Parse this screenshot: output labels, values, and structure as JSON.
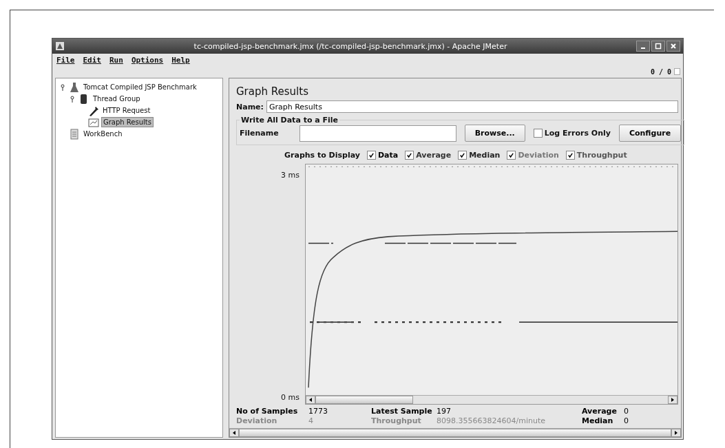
{
  "window": {
    "title": "tc-compiled-jsp-benchmark.jmx (/tc-compiled-jsp-benchmark.jmx) - Apache JMeter"
  },
  "menu": [
    "File",
    "Edit",
    "Run",
    "Options",
    "Help"
  ],
  "counter": "0 / 0",
  "tree": [
    {
      "label": "Tomcat Compiled JSP Benchmark",
      "kind": "plan",
      "expanded": true,
      "selected": false,
      "children": [
        {
          "label": "Thread Group",
          "kind": "threads",
          "expanded": true,
          "selected": false,
          "children": [
            {
              "label": "HTTP Request",
              "kind": "sampler",
              "selected": false
            },
            {
              "label": "Graph Results",
              "kind": "graph",
              "selected": true
            }
          ]
        }
      ]
    },
    {
      "label": "WorkBench",
      "kind": "bench",
      "selected": false
    }
  ],
  "panel": {
    "title": "Graph Results",
    "name_label": "Name:",
    "name_value": "Graph Results",
    "file_group": "Write All Data to a File",
    "filename_label": "Filename",
    "browse": "Browse...",
    "log_errors": {
      "label": "Log Errors Only",
      "checked": false
    },
    "configure": "Configure",
    "graphs_label": "Graphs to Display",
    "graphs": [
      {
        "label": "Data",
        "checked": true,
        "color": "#000000"
      },
      {
        "label": "Average",
        "checked": true,
        "color": "#333333"
      },
      {
        "label": "Median",
        "checked": true,
        "color": "#222222"
      },
      {
        "label": "Deviation",
        "checked": true,
        "color": "#777777"
      },
      {
        "label": "Throughput",
        "checked": true,
        "color": "#555555"
      }
    ],
    "y_max": "3 ms",
    "y_min": "0 ms",
    "stats": [
      {
        "label": "No of Samples",
        "value": "1773",
        "color": "#000000"
      },
      {
        "label": "Latest Sample",
        "value": "197",
        "color": "#000000"
      },
      {
        "label": "Average",
        "value": "0",
        "color": "#000000"
      },
      {
        "label": "Deviation",
        "value": "4",
        "color": "#888888"
      },
      {
        "label": "Throughput",
        "value": "8098.355663824604/minute",
        "color": "#888888"
      },
      {
        "label": "Median",
        "value": "0",
        "color": "#000000"
      }
    ]
  }
}
